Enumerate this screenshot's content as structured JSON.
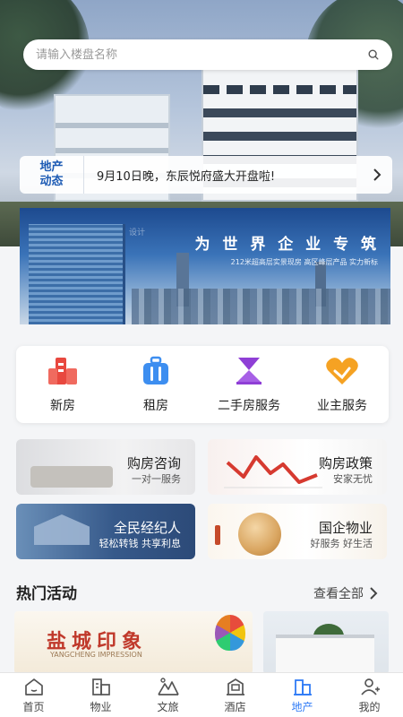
{
  "search": {
    "placeholder": "请输入楼盘名称"
  },
  "news": {
    "tag_line1": "地产",
    "tag_line2": "动态",
    "text": "9月10日晚，东辰悦府盛大开盘啦!"
  },
  "banner": {
    "headline": "为 世 界 企 业 专 筑",
    "subtext": "212米超高层实景现房  高区峰层产品  实力新标",
    "watermark": "设计"
  },
  "services": [
    {
      "label": "新房",
      "icon": "new-house-icon",
      "color": "#e8483f"
    },
    {
      "label": "租房",
      "icon": "suitcase-icon",
      "color": "#3d8ef0"
    },
    {
      "label": "二手房服务",
      "icon": "hourglass-icon",
      "color": "#8f3fd6"
    },
    {
      "label": "业主服务",
      "icon": "heart-hands-icon",
      "color": "#f5a223"
    }
  ],
  "cards": [
    {
      "title": "购房咨询",
      "subtitle": "一对一服务"
    },
    {
      "title": "购房政策",
      "subtitle": "安家无忧"
    },
    {
      "title": "全民经纪人",
      "subtitle": "轻松转钱 共享利息"
    },
    {
      "title": "国企物业",
      "subtitle": "好服务 好生活"
    }
  ],
  "hot": {
    "title": "热门活动",
    "more": "查看全部",
    "activity1": {
      "brand": "盐城印象",
      "en": "YANGCHENG IMPRESSION"
    }
  },
  "tabs": [
    {
      "label": "首页",
      "icon": "home-icon"
    },
    {
      "label": "物业",
      "icon": "property-icon"
    },
    {
      "label": "文旅",
      "icon": "mountain-icon"
    },
    {
      "label": "酒店",
      "icon": "hotel-icon"
    },
    {
      "label": "地产",
      "icon": "real-estate-icon",
      "active": true
    },
    {
      "label": "我的",
      "icon": "user-icon"
    }
  ],
  "colors": {
    "accent": "#2f7bf6",
    "news_tag": "#1d5bb4"
  }
}
